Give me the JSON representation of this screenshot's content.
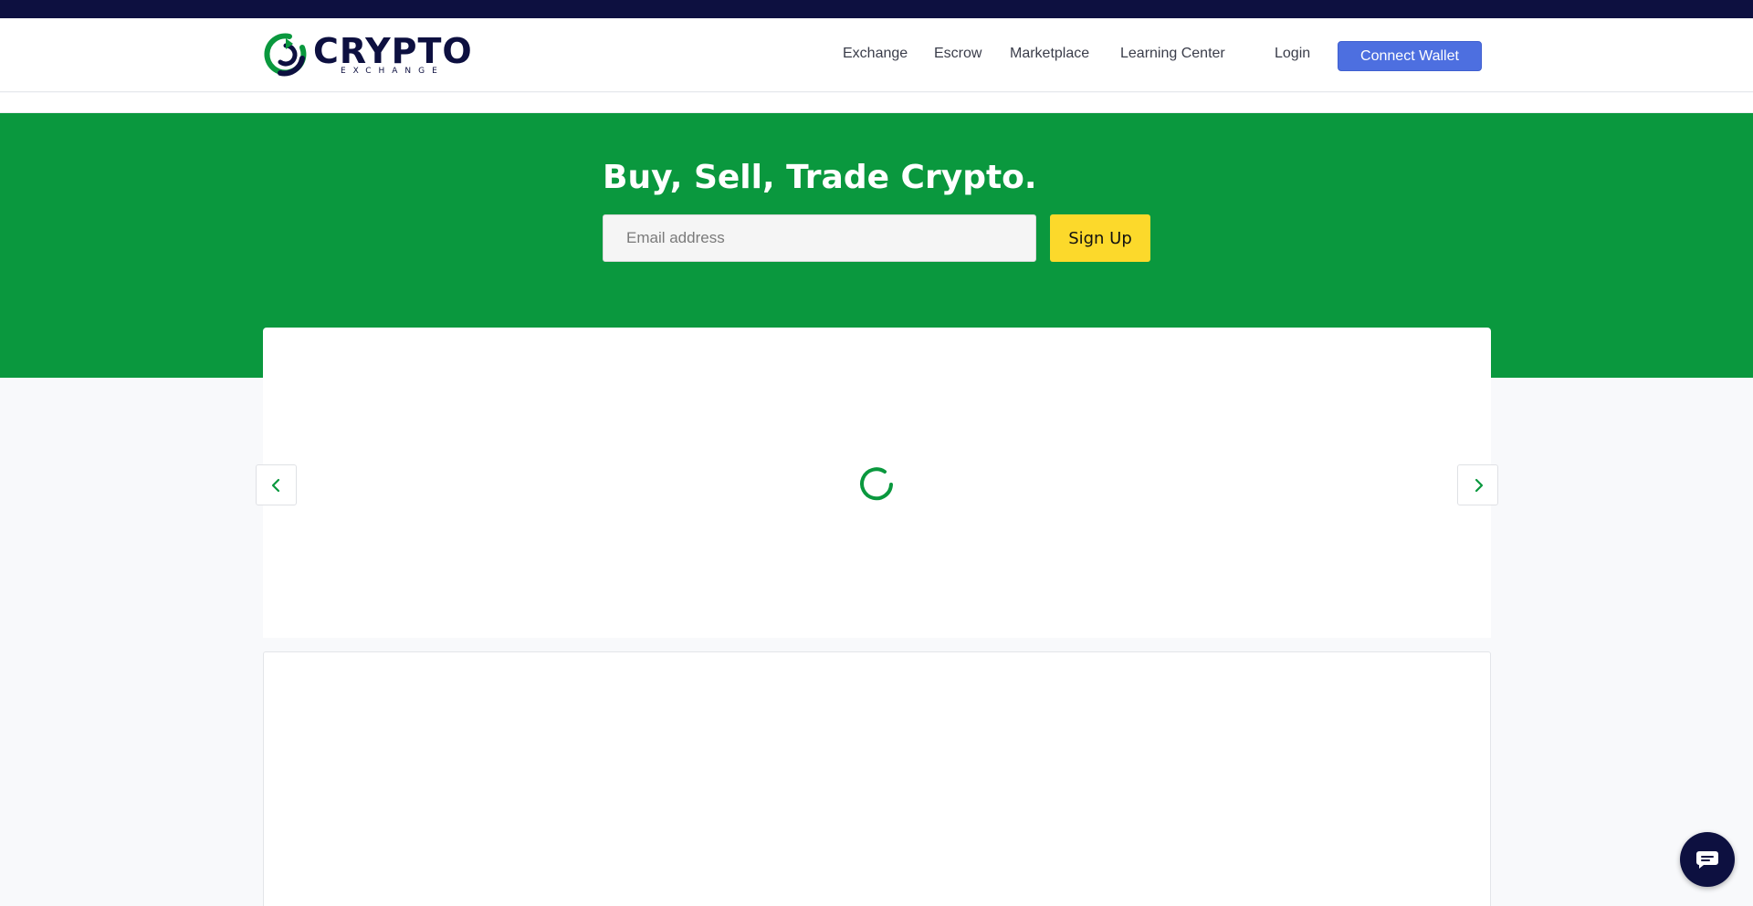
{
  "brand": {
    "name": "CRYPTO",
    "tagline": "EXCHANGE",
    "colors": {
      "navy": "#0d1040",
      "green": "#0a983e",
      "accent_blue": "#4d6fe0",
      "yellow": "#fcd92b"
    }
  },
  "nav": {
    "items": [
      {
        "label": "Exchange"
      },
      {
        "label": "Escrow"
      },
      {
        "label": "Marketplace"
      },
      {
        "label": "Learning Center"
      }
    ],
    "login_label": "Login",
    "connect_wallet_label": "Connect Wallet"
  },
  "hero": {
    "title": "Buy, Sell, Trade Crypto.",
    "email_placeholder": "Email address",
    "signup_label": "Sign Up"
  },
  "carousel": {
    "state": "loading",
    "prev_icon": "chevron-left-icon",
    "next_icon": "chevron-right-icon"
  },
  "chat": {
    "icon": "chat-bubble-icon"
  }
}
